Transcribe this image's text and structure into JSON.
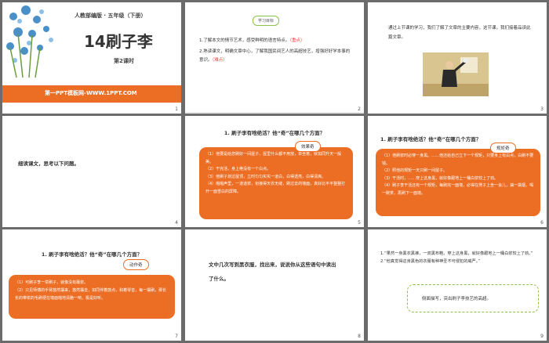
{
  "slides": [
    {
      "number": "1",
      "publisher": "人教部编版 · 五年级（下册）",
      "title": "14刷子李",
      "lesson": "第2课时",
      "footer": "第一PPT模板网-WWW.1PPT.COM"
    },
    {
      "number": "2",
      "tag": "学习目标",
      "goals": [
        {
          "text": "1.了解本文的情节艺术，感受鲜明的语言特点。",
          "mark": "（重点）"
        },
        {
          "text": "2.熟读课文，明确文章中心，了解我国民间艺人的高超技艺，增强好好学本事的意识。",
          "mark": "（难点）"
        }
      ]
    },
    {
      "number": "3",
      "text": "通过上节课的学习，我们了解了文章的主要内容，这节课，我们接着品读此篇文章。"
    },
    {
      "number": "4",
      "text": "细读课文，思考以下问题。"
    },
    {
      "number": "5",
      "question": "1. 刷子李有啥绝活？他“奇”在哪几个方面？",
      "tag": "效果奇",
      "lines": [
        "（1）他要是给您刷好一间屋子，屋里什么都不用放，单坐着，就如同升天一般美。",
        "（2）干完活，身上绝没有一个白点。",
        "（3）他刷子划过屋顶，立时匀匀实实一道白，白得透亮，白得清爽。",
        "（4）啪啪声里，一道道浆，衔接得天衣无缝，刷过去的墙面，真好比平平整整打开一面雪白的屏障。"
      ]
    },
    {
      "number": "6",
      "question": "1. 刷子李有啥绝活？他“奇”在哪几个方面？",
      "tag": "规矩奇",
      "lines": [
        "（1）他刷浆时必穿一身黑。……他还给自己立下一个规矩，只要身上有白点，白刷不要钱。",
        "（2）照他的规矩一天只刷一间屋子。",
        "（3）干活时，……穿上这身黑，就好像跟地上一桶白浆较上了劲。",
        "（4）刷子李干活还有一个规矩，每刷完一面墙，必得在凳子上坐一会儿，抽一袋烟，喝一碗茶，再刷下一面墙。"
      ]
    },
    {
      "number": "7",
      "question": "1. 刷子李有啥绝活？他“奇”在哪几个方面？",
      "tag": "动作奇",
      "lines": [
        "（1）可刷子李一举刷子，就像没有蘸浆。",
        "（2）只见师傅的手臂悠然摆来，悠然摆去，如同伴着鼓点，和着琴音，每一摆刷，那长长的带浆的毛刷便在墙面啪地清脆一响，极是好听。"
      ]
    },
    {
      "number": "8",
      "text": "文中几次写到黑衣服，找出来，说说你从这些语句中读出了什么。"
    },
    {
      "number": "9",
      "quotes": [
        "1.“果然一身黑衣黑裤，一双黑布鞋。穿上这身黑，就好像跟地上一桶白浆较上了劲。”",
        "2.“他真觉得这身黑色的衣服有种神圣不可侵犯的威严。”"
      ],
      "answer": "侧面描写，突出刷子李技艺的高超。"
    }
  ],
  "colors": {
    "accent": "#ec6d24",
    "tag_green": "#8bc34a",
    "mark_red": "#e8423f"
  }
}
